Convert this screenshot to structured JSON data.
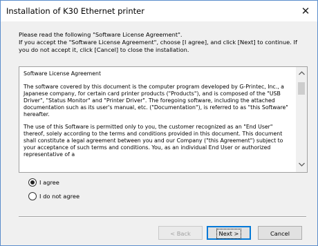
{
  "window": {
    "title": "Installation of K30 Ethernet printer",
    "close_glyph": "✕"
  },
  "intro": {
    "text": "Please read the following \"Software License Agreement\".\nIf you accept the \"Software License Agreement\", choose [I agree], and click [Next] to continue. If you do not accept it, click [Cancel] to close the installation."
  },
  "license": {
    "heading": "Software License Agreement",
    "paragraph_1": "The software covered by this document is the computer program developed by G-Printec, Inc., a Japanese company, for certain card printer products (\"Products\"), and is composed of the \"USB Driver\", \"Status Monitor\" and \"Printer Driver\". The foregoing software, including the attached documentation such as its user's manual, etc. (\"Documentation\"), is referred to as \"this Software\" hereafter.",
    "paragraph_2": "The use of this Software is permitted only to you, the customer recognized as an \"End User\" thereof, solely according to the terms and conditions provided in this document. This document shall constitute a legal agreement between you and our Company (\"this Agreement\") subject to your acceptance of such terms and conditions. You, as an individual End User or authorized representative of a"
  },
  "options": {
    "agree_label": "I agree",
    "disagree_label": "I do not agree",
    "selected": "agree"
  },
  "buttons": {
    "back": "< Back",
    "next": "Next >",
    "cancel": "Cancel"
  },
  "icons": {
    "scroll_up": "chevron-up-icon",
    "scroll_down": "chevron-down-icon",
    "close": "close-icon"
  }
}
